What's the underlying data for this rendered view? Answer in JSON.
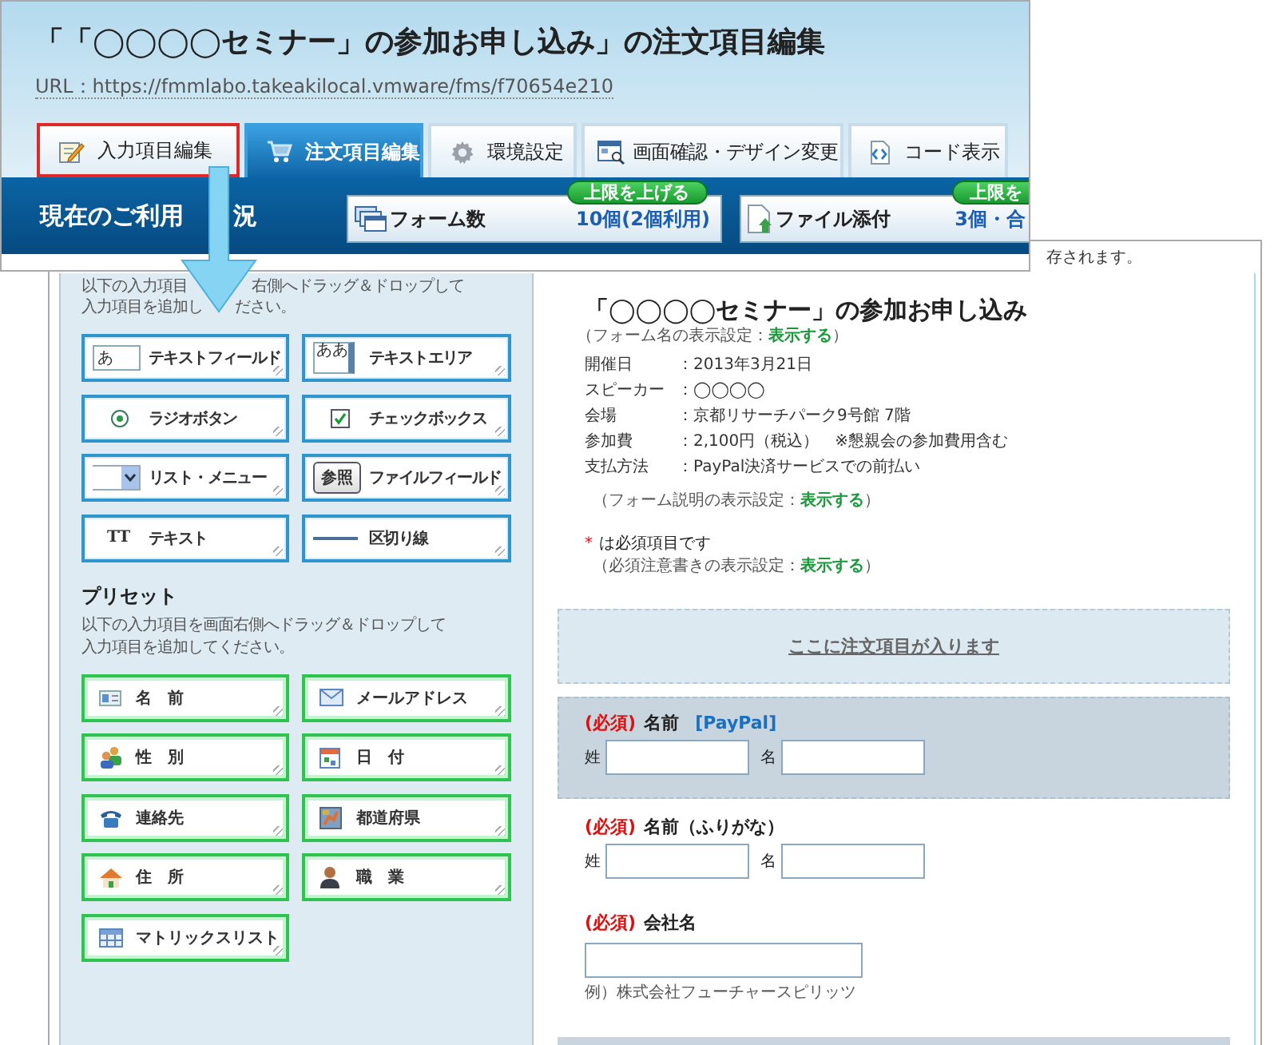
{
  "header": {
    "title": "「「◯◯◯◯セミナー」の参加お申し込み」の注文項目編集",
    "url": "URL：https://fmmlabo.takeakilocal.vmware/fms/f70654e210"
  },
  "tabs": [
    {
      "kind": "edit",
      "label": "入力項目編集",
      "selected": false,
      "callout": true
    },
    {
      "kind": "cart",
      "label": "注文項目編集",
      "selected": true,
      "callout": false
    },
    {
      "kind": "gear",
      "label": "環境設定",
      "selected": false,
      "callout": false
    },
    {
      "kind": "preview",
      "label": "画面確認・デザイン変更",
      "selected": false,
      "callout": false
    },
    {
      "kind": "code",
      "label": "コード表示",
      "selected": false,
      "callout": false
    }
  ],
  "usage": {
    "title_parts": [
      "現在のご利用",
      "況"
    ],
    "stats": [
      {
        "kind": "forms",
        "label": "フォーム数",
        "value": "10個(2個利用)",
        "button": "上限を上げる"
      },
      {
        "kind": "file",
        "label": "ファイル添付",
        "value": "3個・合",
        "button": "上限を"
      }
    ]
  },
  "notice": "存されます。",
  "palette": {
    "intro_parts": [
      [
        "以下の入力項目",
        "右側へドラッグ＆ドロップして"
      ],
      [
        "入力項目を追加し",
        "ださい。"
      ]
    ],
    "items": [
      {
        "kind": "textfield",
        "label": "テキストフィールド",
        "icon_text": "あ"
      },
      {
        "kind": "textarea",
        "label": "テキストエリア",
        "icon_text": "ああ"
      },
      {
        "kind": "radio",
        "label": "ラジオボタン"
      },
      {
        "kind": "checkbox",
        "label": "チェックボックス"
      },
      {
        "kind": "select",
        "label": "リスト・メニュー"
      },
      {
        "kind": "file",
        "label": "ファイルフィールド",
        "icon_text": "参照"
      },
      {
        "kind": "text",
        "label": "テキスト",
        "icon_text": "TT"
      },
      {
        "kind": "divider",
        "label": "区切り線"
      }
    ]
  },
  "presets": {
    "title": "プリセット",
    "intro_lines": [
      "以下の入力項目を画面右側へドラッグ＆ドロップして",
      "入力項目を追加してください。"
    ],
    "items": [
      {
        "kind": "name",
        "label": "名　前"
      },
      {
        "kind": "email",
        "label": "メールアドレス"
      },
      {
        "kind": "gender",
        "label": "性　別"
      },
      {
        "kind": "date",
        "label": "日　付"
      },
      {
        "kind": "contact",
        "label": "連絡先"
      },
      {
        "kind": "prefecture",
        "label": "都道府県"
      },
      {
        "kind": "address",
        "label": "住　所"
      },
      {
        "kind": "job",
        "label": "職　業"
      },
      {
        "kind": "matrix",
        "label": "マトリックスリスト"
      }
    ]
  },
  "form": {
    "title": "「◯◯◯◯セミナー」の参加お申し込み",
    "title_setting": "（フォーム名の表示設定：**表示する**）",
    "info": [
      {
        "label": "開催日",
        "value": "：2013年3月21日"
      },
      {
        "label": "スピーカー",
        "value": "：◯◯◯◯"
      },
      {
        "label": "会場",
        "value": "：京都リサーチパーク9号館 7階"
      },
      {
        "label": "参加費",
        "value": "：2,100円（税込）　※懇親会の参加費用含む"
      },
      {
        "label": "支払方法",
        "value": "：PayPal決済サービスでの前払い"
      }
    ],
    "desc_setting": "（フォーム説明の表示設定：**表示する**）",
    "required_mark": "*",
    "required_note": "は必須項目です",
    "required_setting": "（必須注意書きの表示設定：**表示する**）",
    "dropzone": "ここに注文項目が入ります",
    "fields": [
      {
        "kind": "split",
        "required_label": "(必須)",
        "label": "名前",
        "tag": "[PayPal]",
        "highlighted": true,
        "inputs": [
          {
            "label": "姓"
          },
          {
            "label": "名"
          }
        ]
      },
      {
        "kind": "split",
        "required_label": "(必須)",
        "label": "名前（ふりがな）",
        "highlighted": false,
        "inputs": [
          {
            "label": "姓"
          },
          {
            "label": "名"
          }
        ]
      },
      {
        "kind": "single",
        "required_label": "(必須)",
        "label": "会社名",
        "highlighted": false,
        "example": "例）株式会社フューチャースピリッツ"
      }
    ]
  }
}
